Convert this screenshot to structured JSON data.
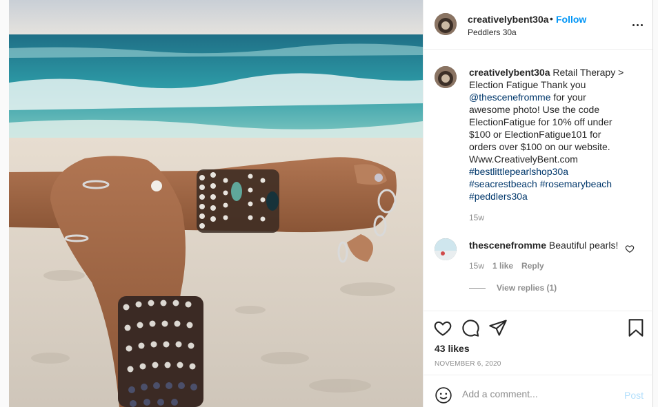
{
  "post": {
    "username": "creativelybent30a",
    "dot": "•",
    "follow_label": "Follow",
    "location": "Peddlers 30a"
  },
  "caption": {
    "username": "creativelybent30a",
    "text_1": " Retail Therapy > Election Fatigue Thank you ",
    "mention": "@thescenefromme",
    "text_2": " for your awesome photo! Use the code ElectionFatigue for 10% off under $100 or ElectionFatigue101 for orders over $100 on our website. Www.CreativelyBent.com ",
    "hashtag_1": "#bestlittlepearlshop30a",
    "hashtag_2": "#seacrestbeach",
    "hashtag_3": "#rosemarybeach",
    "hashtag_4": "#peddlers30a",
    "time": "15w"
  },
  "comment": {
    "username": "thescenefromme",
    "text": " Beautiful pearls!",
    "time": "15w",
    "likes": "1 like",
    "reply_label": "Reply",
    "view_replies": "View replies (1)"
  },
  "actions": {
    "likes": "43 likes",
    "date": "NOVEMBER 6, 2020",
    "icons": [
      "heart-icon",
      "comment-icon",
      "share-icon",
      "bookmark-icon"
    ]
  },
  "add_comment": {
    "placeholder": "Add a comment...",
    "post_label": "Post"
  },
  "colors": {
    "link": "#00376b",
    "follow": "#0095f6",
    "post_disabled": "#b2dffc",
    "muted": "#8e8e8e"
  }
}
